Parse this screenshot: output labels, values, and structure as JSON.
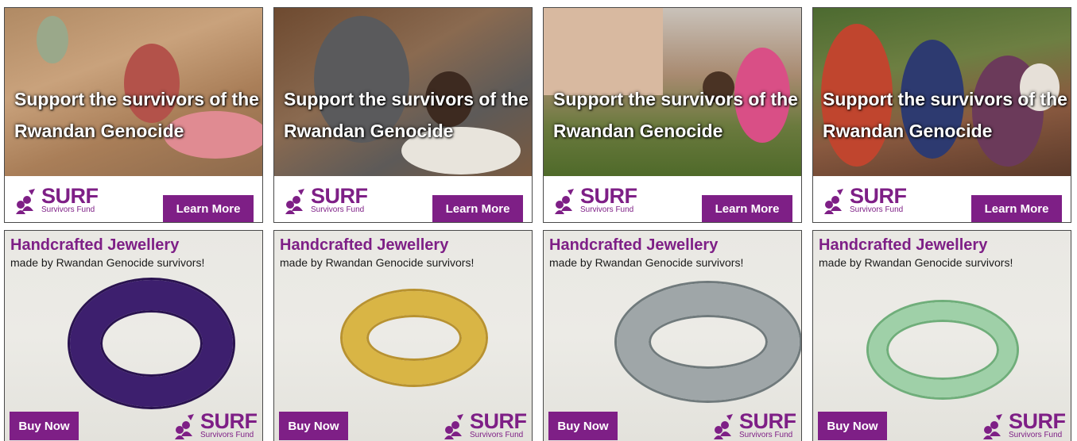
{
  "survivor_ads": [
    {
      "headline": "Support the survivors of the Rwandan Genocide",
      "button": "Learn More",
      "logo_word": "SURF",
      "logo_sub": "Survivors Fund"
    },
    {
      "headline": "Support the survivors of the Rwandan Genocide",
      "button": "Learn More",
      "logo_word": "SURF",
      "logo_sub": "Survivors Fund"
    },
    {
      "headline": "Support the survivors of the Rwandan Genocide",
      "button": "Learn More",
      "logo_word": "SURF",
      "logo_sub": "Survivors Fund"
    },
    {
      "headline": "Support the survivors of the Rwandan Genocide",
      "button": "Learn More",
      "logo_word": "SURF",
      "logo_sub": "Survivors Fund"
    }
  ],
  "jewellery_ads": [
    {
      "title": "Handcrafted Jewellery",
      "subtitle": "made by Rwandan Genocide survivors!",
      "button": "Buy Now",
      "logo_word": "SURF",
      "logo_sub": "Survivors Fund",
      "bracelet_color": "#3d1f6e"
    },
    {
      "title": "Handcrafted Jewellery",
      "subtitle": "made by Rwandan Genocide survivors!",
      "button": "Buy Now",
      "logo_word": "SURF",
      "logo_sub": "Survivors Fund",
      "bracelet_color": "#d9b545"
    },
    {
      "title": "Handcrafted Jewellery",
      "subtitle": "made by Rwandan Genocide survivors!",
      "button": "Buy Now",
      "logo_word": "SURF",
      "logo_sub": "Survivors Fund",
      "bracelet_color": "#9fa6a8"
    },
    {
      "title": "Handcrafted Jewellery",
      "subtitle": "made by Rwandan Genocide survivors!",
      "button": "Buy Now",
      "logo_word": "SURF",
      "logo_sub": "Survivors Fund",
      "bracelet_color": "#9fd0a8"
    }
  ],
  "colors": {
    "brand": "#7e1f86",
    "text_dark": "#1a1a1a",
    "border": "#4a4a4a"
  },
  "icons": {
    "logo": "surf-people-icon"
  }
}
